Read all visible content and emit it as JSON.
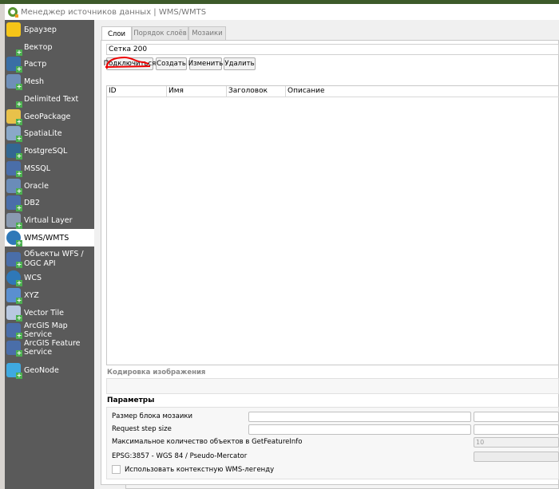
{
  "window": {
    "title": "Менеджер источников данных | WMS/WMTS"
  },
  "sidebar": {
    "items": [
      {
        "label": "Браузер",
        "icon": "folder-icon",
        "color": "#f5c518"
      },
      {
        "label": "Вектор",
        "icon": "vector-icon",
        "color": "#5a5a5a"
      },
      {
        "label": "Растр",
        "icon": "raster-icon",
        "color": "#3a6ea5"
      },
      {
        "label": "Mesh",
        "icon": "mesh-icon",
        "color": "#6f8fb8"
      },
      {
        "label": "Delimited Text",
        "icon": "delimited-text-icon",
        "color": "#5a5a5a"
      },
      {
        "label": "GeoPackage",
        "icon": "geopackage-icon",
        "color": "#e8c14a"
      },
      {
        "label": "SpatiaLite",
        "icon": "spatialite-icon",
        "color": "#8aa8c8"
      },
      {
        "label": "PostgreSQL",
        "icon": "postgresql-icon",
        "color": "#336791"
      },
      {
        "label": "MSSQL",
        "icon": "mssql-icon",
        "color": "#4a6ea9"
      },
      {
        "label": "Oracle",
        "icon": "oracle-icon",
        "color": "#6a8cb8"
      },
      {
        "label": "DB2",
        "icon": "db2-icon",
        "color": "#4a6ea9"
      },
      {
        "label": "Virtual Layer",
        "icon": "virtual-layer-icon",
        "color": "#8a9ab0"
      },
      {
        "label": "WMS/WMTS",
        "icon": "wms-globe-icon",
        "color": "#2f78b8"
      },
      {
        "label": "Объекты WFS / OGC API",
        "icon": "wfs-icon",
        "color": "#4a6ea9"
      },
      {
        "label": "WCS",
        "icon": "wcs-globe-icon",
        "color": "#2f78b8"
      },
      {
        "label": "XYZ",
        "icon": "xyz-grid-icon",
        "color": "#5a8fd0"
      },
      {
        "label": "Vector Tile",
        "icon": "vector-tile-icon",
        "color": "#b8c8e0"
      },
      {
        "label": "ArcGIS Map Service",
        "icon": "arcgis-map-icon",
        "color": "#4a6ea9"
      },
      {
        "label": "ArcGIS Feature Service",
        "icon": "arcgis-feature-icon",
        "color": "#4a6ea9"
      },
      {
        "label": "GeoNode",
        "icon": "geonode-icon",
        "color": "#3fa9e0"
      }
    ]
  },
  "tabs": [
    "Слои",
    "Порядок слоёв",
    "Мозаики"
  ],
  "connection": {
    "selected": "Сетка 200"
  },
  "buttons": {
    "connect": "Подключиться",
    "create": "Создать",
    "edit": "Изменить",
    "delete": "Удалить"
  },
  "table": {
    "columns": [
      "ID",
      "Имя",
      "Заголовок",
      "Описание"
    ]
  },
  "encoding": {
    "label": "Кодировка изображения"
  },
  "params": {
    "title": "Параметры",
    "tile_size": "Размер блока мозаики",
    "step_size": "Request step size",
    "max_features": "Максимальное количество объектов в GetFeatureInfo",
    "max_features_value": "10",
    "crs": "EPSG:3857 - WGS 84 / Pseudo-Mercator",
    "contextual_legend": "Использовать контекстную WMS-легенду"
  }
}
